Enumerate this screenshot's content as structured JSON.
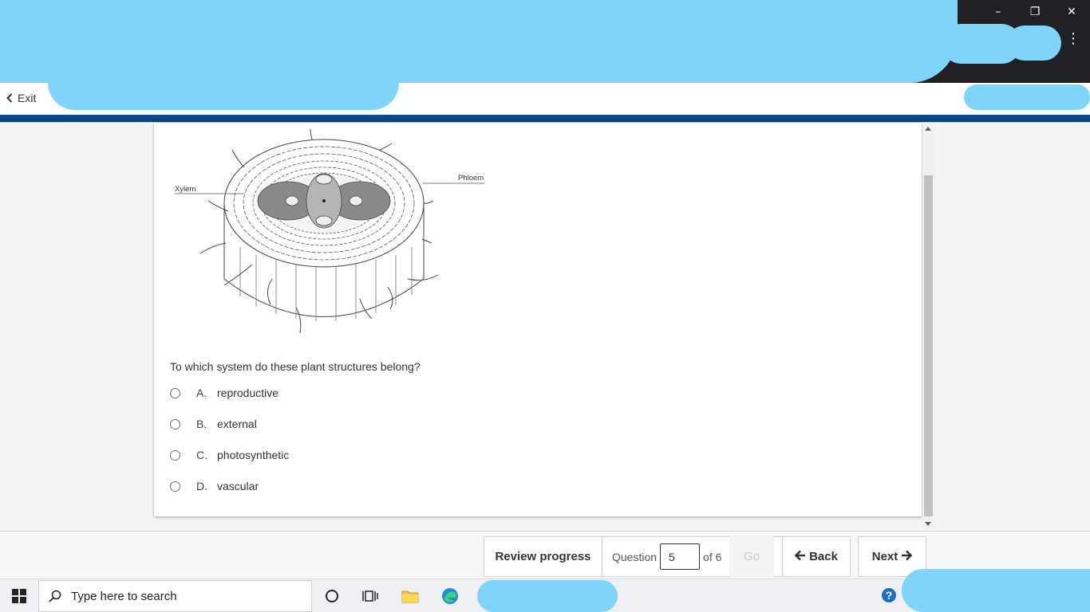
{
  "header": {
    "exit_label": "Exit"
  },
  "question": {
    "figure_labels": {
      "xylem": "Xylem",
      "phloem": "Phloem"
    },
    "prompt": "To which system do these plant structures belong?",
    "choices": [
      {
        "letter": "A.",
        "text": "reproductive"
      },
      {
        "letter": "B.",
        "text": "external"
      },
      {
        "letter": "C.",
        "text": "photosynthetic"
      },
      {
        "letter": "D.",
        "text": "vascular"
      }
    ]
  },
  "toolbar": {
    "review_label": "Review progress",
    "question_label": "Question",
    "current_question": "5",
    "of_total": "of 6",
    "go_label": "Go",
    "back_label": "Back",
    "next_label": "Next"
  },
  "taskbar": {
    "search_placeholder": "Type here to search"
  },
  "colors": {
    "header_rule": "#0e4d8a",
    "redaction": "#7fd4fb"
  }
}
